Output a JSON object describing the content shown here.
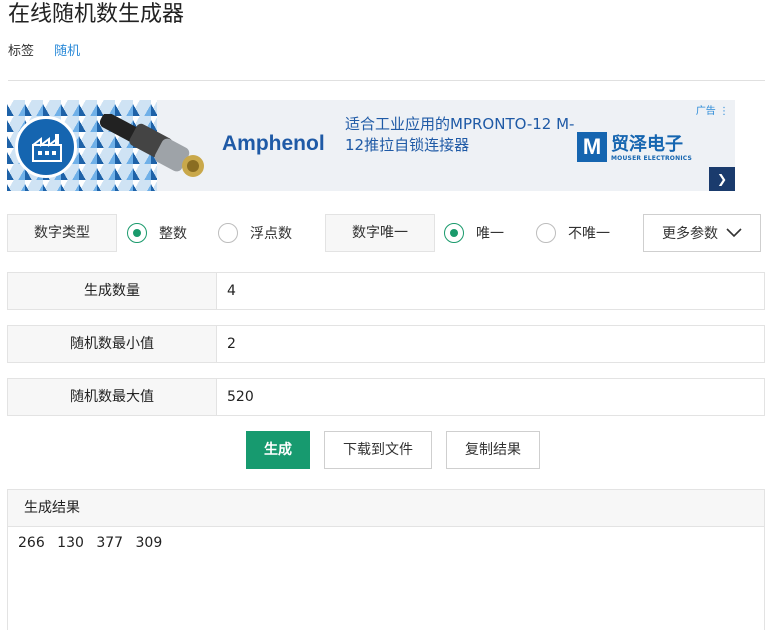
{
  "page": {
    "title": "在线随机数生成器"
  },
  "tags": {
    "label": "标签",
    "link": "随机"
  },
  "ad": {
    "label": "广告 ⋮",
    "brand": "Amphenol",
    "text": "适合工业应用的MPRONTO-12 M-12推拉自锁连接器",
    "mouser_cn": "贸泽电子",
    "mouser_en": "MOUSER ELECTRONICS",
    "mouser_logo": "M",
    "arrow": "❯"
  },
  "options": {
    "number_type_label": "数字类型",
    "integer": "整数",
    "float": "浮点数",
    "unique_label": "数字唯一",
    "unique": "唯一",
    "not_unique": "不唯一",
    "more_params": "更多参数",
    "selected_type": "整数",
    "selected_unique": "唯一"
  },
  "params": {
    "count_label": "生成数量",
    "count_value": "4",
    "min_label": "随机数最小值",
    "min_value": "2",
    "max_label": "随机数最大值",
    "max_value": "520"
  },
  "buttons": {
    "generate": "生成",
    "download": "下载到文件",
    "copy": "复制结果"
  },
  "result": {
    "header": "生成结果",
    "values": "266 130 377 309"
  },
  "colors": {
    "accent": "#179a6f",
    "link": "#2b8ad8",
    "ad_blue": "#1f5aa6"
  }
}
